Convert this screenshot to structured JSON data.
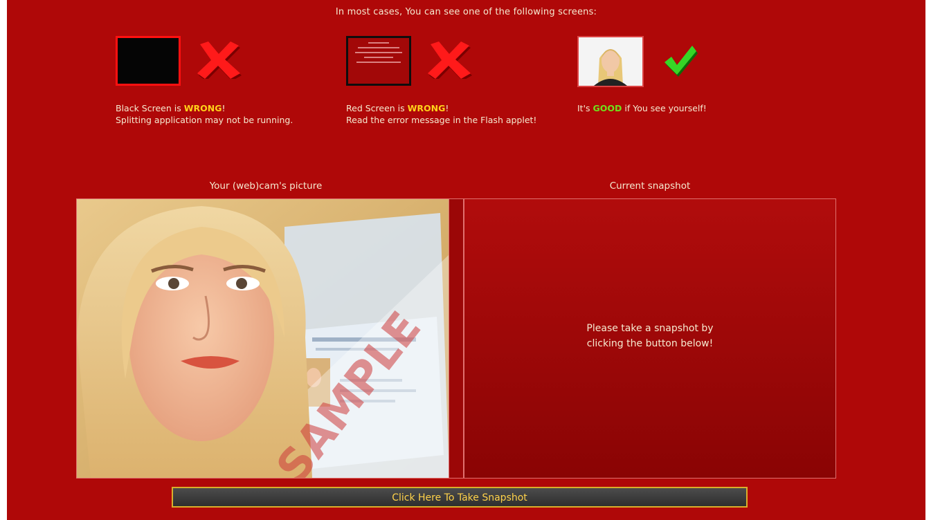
{
  "intro": "In most cases, You can see one of the following screens:",
  "examples": [
    {
      "lead": "Black Screen is ",
      "highlight": "WRONG",
      "tail": "!",
      "detail": "Splitting application may not be running.",
      "mark": "cross-icon"
    },
    {
      "lead": "Red Screen is ",
      "highlight": "WRONG",
      "tail": "!",
      "detail": "Read the error message in the Flash applet!",
      "mark": "cross-icon"
    },
    {
      "lead": "It's ",
      "highlight": "GOOD",
      "tail": " if You see yourself!",
      "detail": "",
      "mark": "checkmark-icon"
    }
  ],
  "camera": {
    "label": "Your (web)cam's picture",
    "watermark": "SAMPLE"
  },
  "snapshot": {
    "label": "Current snapshot",
    "message": "Please take a snapshot by\nclicking the button below!"
  },
  "button": {
    "label": "Click Here To Take Snapshot"
  },
  "colors": {
    "background": "#af0808",
    "wrong_highlight": "#ffd21a",
    "good_highlight": "#6fe21c",
    "button_text": "#ffd24a",
    "button_border": "#d9b02c"
  }
}
